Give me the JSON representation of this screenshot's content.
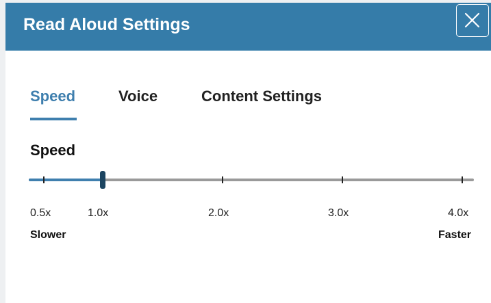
{
  "dialog": {
    "title": "Read Aloud Settings",
    "close_icon": "close-icon",
    "header_color": "#357ca9"
  },
  "tabs": [
    {
      "label": "Speed",
      "active": true
    },
    {
      "label": "Voice",
      "active": false
    },
    {
      "label": "Content Settings",
      "active": false
    }
  ],
  "speed": {
    "label": "Speed",
    "min": 0.5,
    "max": 4.0,
    "value": 1.0,
    "ticks": [
      "0.5x",
      "1.0x",
      "2.0x",
      "3.0x",
      "4.0x"
    ],
    "tick_values": [
      0.5,
      1.0,
      2.0,
      3.0,
      4.0
    ],
    "min_label": "Slower",
    "max_label": "Faster",
    "accent_color": "#3f7fae",
    "thumb_color": "#1c4561"
  }
}
